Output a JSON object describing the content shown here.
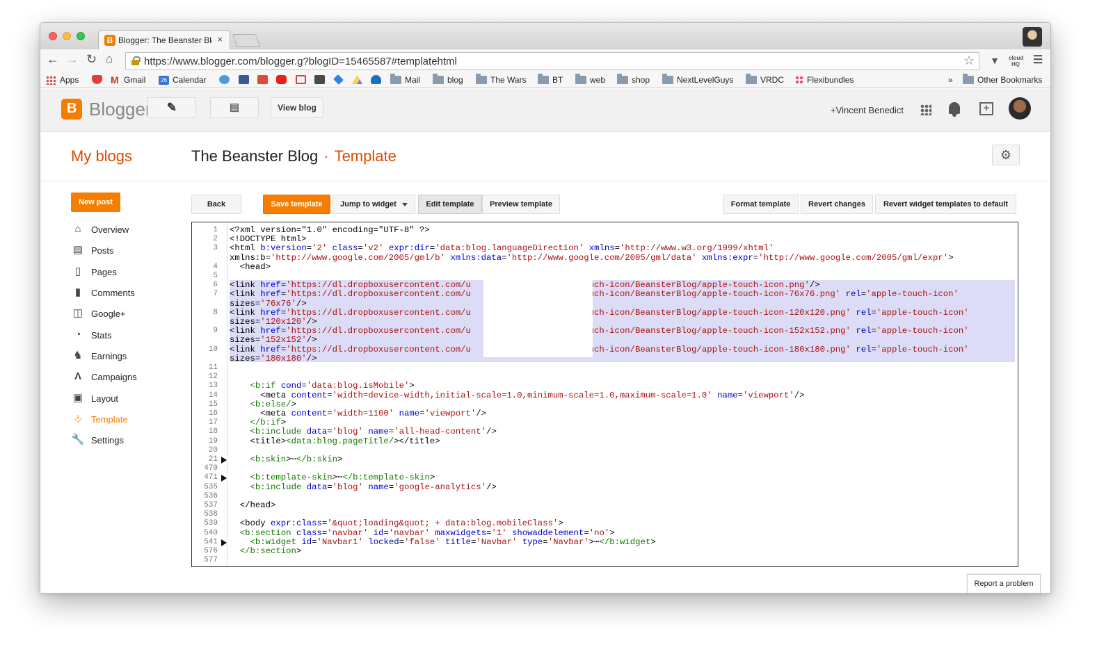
{
  "browser": {
    "tab_title": "Blogger: The Beanster Blog",
    "tab_close": "×",
    "url": "https://www.blogger.com/blogger.g?blogID=15465587#templatehtml",
    "extensions": [
      "pocket-icon",
      "cloudhq-icon",
      "menu-icon"
    ],
    "bookmarks": [
      {
        "label": "Apps",
        "icon": "apps-icon",
        "color": "#d44"
      },
      {
        "label": "",
        "icon": "pocket-icon",
        "color": "#e0403d"
      },
      {
        "label": "Gmail",
        "icon": "gmail-icon",
        "color": "#d93025"
      },
      {
        "label": "Calendar",
        "icon": "calendar-icon",
        "color": "#3b73d8"
      },
      {
        "label": "",
        "icon": "twitter-icon",
        "color": "#4a99e9"
      },
      {
        "label": "",
        "icon": "facebook-icon",
        "color": "#3b5998"
      },
      {
        "label": "",
        "icon": "google-plus-icon",
        "color": "#dd4b39"
      },
      {
        "label": "",
        "icon": "youtube-icon",
        "color": "#e62117"
      },
      {
        "label": "",
        "icon": "bookmark-red-icon",
        "color": "#e03c3c"
      },
      {
        "label": "",
        "icon": "stack-icon",
        "color": "#4a4a4a"
      },
      {
        "label": "",
        "icon": "dropbox-icon",
        "color": "#2f84de"
      },
      {
        "label": "",
        "icon": "drive-icon",
        "color": "#1fa463"
      },
      {
        "label": "",
        "icon": "cloud-icon",
        "color": "#1c6fbf"
      },
      {
        "label": "Mail",
        "icon": "folder-icon"
      },
      {
        "label": "blog",
        "icon": "folder-icon"
      },
      {
        "label": "The Wars",
        "icon": "folder-icon"
      },
      {
        "label": "BT",
        "icon": "folder-icon"
      },
      {
        "label": "web",
        "icon": "folder-icon"
      },
      {
        "label": "shop",
        "icon": "folder-icon"
      },
      {
        "label": "NextLevelGuys",
        "icon": "folder-icon"
      },
      {
        "label": "VRDC",
        "icon": "folder-icon"
      },
      {
        "label": "Flexibundles",
        "icon": "flexibundles-icon",
        "color": "#e64b8b"
      }
    ],
    "overflow_label": "»",
    "other_bookmarks": "Other Bookmarks"
  },
  "header": {
    "brand": "Blogger",
    "view_blog": "View blog",
    "user": "+Vincent Benedict"
  },
  "title": {
    "my_blogs": "My blogs",
    "blog_name": "The Beanster Blog",
    "separator": "·",
    "section": "Template"
  },
  "sidebar": {
    "new_post": "New post",
    "items": [
      {
        "label": "Overview",
        "icon": "home-icon",
        "active": false
      },
      {
        "label": "Posts",
        "icon": "posts-icon",
        "active": false
      },
      {
        "label": "Pages",
        "icon": "pages-icon",
        "active": false
      },
      {
        "label": "Comments",
        "icon": "comments-icon",
        "active": false
      },
      {
        "label": "Google+",
        "icon": "google-plus-icon",
        "active": false
      },
      {
        "label": "Stats",
        "icon": "stats-icon",
        "active": false
      },
      {
        "label": "Earnings",
        "icon": "trophy-icon",
        "active": false
      },
      {
        "label": "Campaigns",
        "icon": "campaigns-icon",
        "active": false
      },
      {
        "label": "Layout",
        "icon": "layout-icon",
        "active": false
      },
      {
        "label": "Template",
        "icon": "template-icon",
        "active": true
      },
      {
        "label": "Settings",
        "icon": "wrench-icon",
        "active": false
      }
    ]
  },
  "toolbar": {
    "back": "Back",
    "save": "Save template",
    "jump": "Jump to widget",
    "edit": "Edit template",
    "preview": "Preview template",
    "format": "Format template",
    "revert": "Revert changes",
    "revert_widgets": "Revert widget templates to default"
  },
  "editor": {
    "line_numbers": [
      "1",
      "2",
      "3",
      "",
      "4",
      "5",
      "6",
      "7",
      "",
      "8",
      "",
      "9",
      "",
      "10",
      "",
      "11",
      "12",
      "13",
      "14",
      "15",
      "16",
      "17",
      "18",
      "19",
      "20",
      "21",
      "470",
      "471",
      "535",
      "536",
      "537",
      "538",
      "539",
      "540",
      "541",
      "576",
      "577"
    ],
    "folded_lines": [
      "21",
      "471",
      "541"
    ],
    "code": [
      "<?xml version=\"1.0\" encoding=\"UTF-8\" ?>",
      "<!DOCTYPE html>",
      "<html b:version='2' class='v2' expr:dir='data:blog.languageDirection' xmlns='http://www.w3.org/1999/xhtml'",
      "xmlns:b='http://www.google.com/2005/gml/b' xmlns:data='http://www.google.com/2005/gml/data' xmlns:expr='http://www.google.com/2005/gml/expr'>",
      "  <head>",
      "",
      "<link href='https://dl.dropboxusercontent.com/u                    -touch-icon/BeansterBlog/apple-touch-icon.png'/>",
      "<link href='https://dl.dropboxusercontent.com/u                    -touch-icon/BeansterBlog/apple-touch-icon-76x76.png' rel='apple-touch-icon'",
      "sizes='76x76'/>",
      "<link href='https://dl.dropboxusercontent.com/u                    -touch-icon/BeansterBlog/apple-touch-icon-120x120.png' rel='apple-touch-icon'",
      "sizes='120x120'/>",
      "<link href='https://dl.dropboxusercontent.com/u                    -touch-icon/BeansterBlog/apple-touch-icon-152x152.png' rel='apple-touch-icon'",
      "sizes='152x152'/>",
      "<link href='https://dl.dropboxusercontent.com/u                    -touch-icon/BeansterBlog/apple-touch-icon-180x180.png' rel='apple-touch-icon'",
      "sizes='180x180'/>",
      "",
      "",
      "    <b:if cond='data:blog.isMobile'>",
      "      <meta content='width=device-width,initial-scale=1.0,minimum-scale=1.0,maximum-scale=1.0' name='viewport'/>",
      "    <b:else/>",
      "      <meta content='width=1100' name='viewport'/>",
      "    </b:if>",
      "    <b:include data='blog' name='all-head-content'/>",
      "    <title><data:blog.pageTitle/></title>",
      "",
      "    <b:skin>⋯</b:skin>",
      "",
      "    <b:template-skin>⋯</b:template-skin>",
      "    <b:include data='blog' name='google-analytics'/>",
      "",
      "  </head>",
      "",
      "  <body expr:class='&quot;loading&quot; + data:blog.mobileClass'>",
      "  <b:section class='navbar' id='navbar' maxwidgets='1' showaddelement='no'>",
      "    <b:widget id='Navbar1' locked='false' title='Navbar' type='Navbar'>⋯</b:widget>",
      "  </b:section>",
      ""
    ]
  },
  "footer": {
    "report": "Report a problem"
  },
  "colors": {
    "accent": "#f57d00",
    "accent_text": "#dd4b00",
    "selection": "#dcdcf6",
    "tag": "#117700",
    "attr": "#0000cc",
    "string": "#aa1111"
  }
}
